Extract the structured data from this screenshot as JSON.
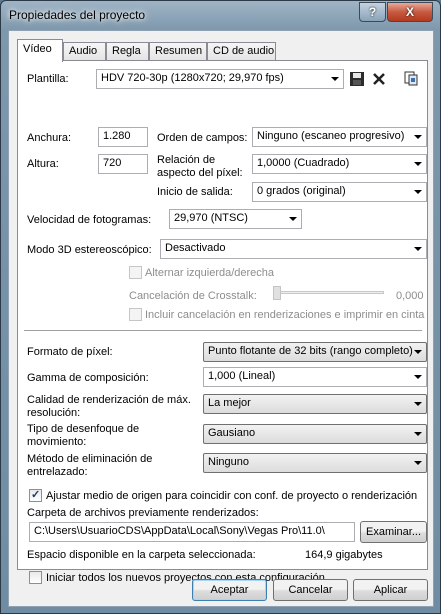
{
  "window": {
    "title": "Propiedades del proyecto",
    "help_label": "?",
    "close_label": "X"
  },
  "tabs": [
    {
      "label": "Vídeo"
    },
    {
      "label": "Audio"
    },
    {
      "label": "Regla"
    },
    {
      "label": "Resumen"
    },
    {
      "label": "CD de audio"
    }
  ],
  "video": {
    "template_label": "Plantilla:",
    "template_value": "HDV 720-30p (1280x720; 29,970 fps)",
    "width_label": "Anchura:",
    "width_value": "1.280",
    "height_label": "Altura:",
    "height_value": "720",
    "field_order_label": "Orden de campos:",
    "field_order_value": "Ninguno (escaneo progresivo)",
    "pixel_ratio_label_1": "Relación de",
    "pixel_ratio_label_2": "aspecto del píxel:",
    "pixel_ratio_value": "1,0000 (Cuadrado)",
    "output_start_label": "Inicio de salida:",
    "output_start_value": "0 grados (original)",
    "frame_rate_label": "Velocidad de fotogramas:",
    "frame_rate_value": "29,970 (NTSC)",
    "stereo_label": "Modo 3D estereoscópico:",
    "stereo_value": "Desactivado",
    "swap_label": "Alternar izquierda/derecha",
    "crosstalk_label": "Cancelación de Crosstalk:",
    "crosstalk_value": "0,000",
    "include_crosstalk_label": "Incluir cancelación en renderizaciones e imprimir en cinta",
    "pixel_format_label": "Formato de píxel:",
    "pixel_format_value": "Punto flotante de 32 bits (rango completo)",
    "compositing_label": "Gamma de composición:",
    "compositing_value": "1,000 (Lineal)",
    "render_quality_label_1": "Calidad de renderización de máx.",
    "render_quality_label_2": "resolución:",
    "render_quality_value": "La mejor",
    "blur_label_1": "Tipo de desenfoque de",
    "blur_label_2": "movimiento:",
    "blur_value": "Gausiano",
    "deinterlace_label_1": "Método de eliminación de",
    "deinterlace_label_2": "entrelazado:",
    "deinterlace_value": "Ninguno",
    "adjust_source_label": "Ajustar medio de origen para coincidir con conf. de proyecto o renderización",
    "prerender_folder_label": "Carpeta de archivos previamente renderizados:",
    "prerender_folder_value": "C:\\Users\\UsuarioCDS\\AppData\\Local\\Sony\\Vegas Pro\\11.0\\",
    "browse_label": "Examinar...",
    "free_space_label": "Espacio disponible en la carpeta seleccionada:",
    "free_space_value": "164,9 gigabytes",
    "start_all_label": "Iniciar todos los nuevos proyectos con esta configuración"
  },
  "footer": {
    "ok_label": "Aceptar",
    "cancel_label": "Cancelar",
    "apply_label": "Aplicar"
  },
  "colors": {
    "accent": "#3c7fb1",
    "disabled_text": "#8d8d8d",
    "close_red": "#c75a40"
  }
}
